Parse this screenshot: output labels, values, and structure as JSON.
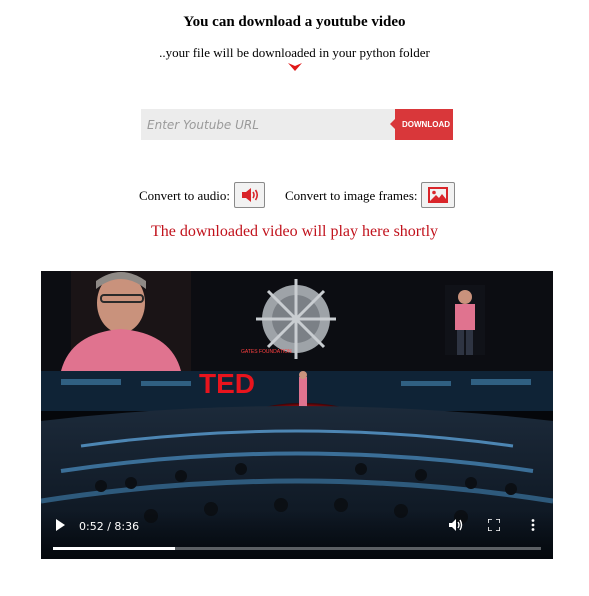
{
  "header": {
    "title": "You can download a youtube video",
    "subtitle": "..your file will be downloaded in your python folder"
  },
  "search": {
    "placeholder": "Enter Youtube URL",
    "value": ""
  },
  "download_button": {
    "label": "DOWNLOAD"
  },
  "convert": {
    "audio_label": "Convert to audio:",
    "audio_icon": "speaker-icon",
    "image_label": "Convert to image frames:",
    "image_icon": "image-icon"
  },
  "status": {
    "message": "The downloaded video will play here shortly"
  },
  "video": {
    "time_display": "0:52 / 8:36",
    "progress": 0.25,
    "stage_text": "TED"
  },
  "colors": {
    "accent": "#d9373a",
    "status_text": "#c1121c"
  }
}
